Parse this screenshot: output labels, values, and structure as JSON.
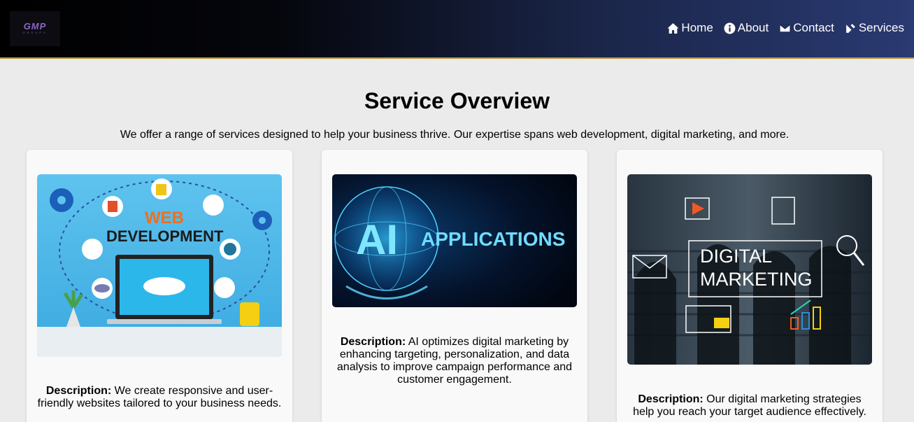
{
  "brand": {
    "logo_text": "GMP",
    "logo_sub": "GROUPS"
  },
  "nav": [
    {
      "label": "Home",
      "icon": "home-icon"
    },
    {
      "label": "About",
      "icon": "info-icon"
    },
    {
      "label": "Contact",
      "icon": "envelope-icon"
    },
    {
      "label": "Services",
      "icon": "services-icon"
    }
  ],
  "main": {
    "title": "Service Overview",
    "intro": "We offer a range of services designed to help your business thrive. Our expertise spans web development, digital marketing, and more."
  },
  "cards": [
    {
      "image_text": [
        "WEB",
        "DEVELOPMENT"
      ],
      "desc_label": "Description:",
      "desc_text": "We create responsive and user-friendly websites tailored to your business needs."
    },
    {
      "image_text": [
        "AI",
        "APPLICATIONS"
      ],
      "desc_label": "Description:",
      "desc_text": "AI optimizes digital marketing by enhancing targeting, personalization, and data analysis to improve campaign performance and customer engagement."
    },
    {
      "image_text": [
        "DIGITAL",
        "MARKETING"
      ],
      "desc_label": "Description:",
      "desc_text": "Our digital marketing strategies help you reach your target audience effectively."
    }
  ],
  "colors": {
    "nav_accent": "#b8923a",
    "card_bg": "#f9f9f9",
    "page_bg": "#ebebeb"
  }
}
